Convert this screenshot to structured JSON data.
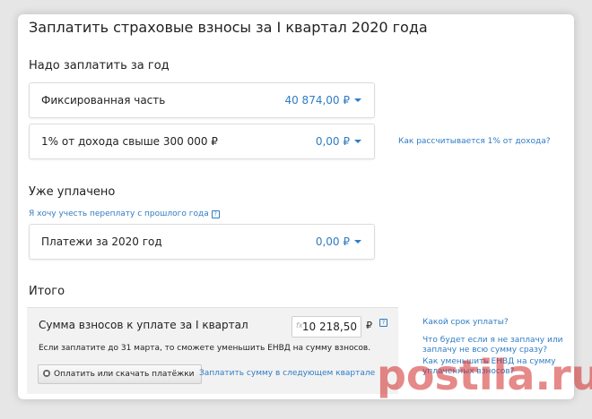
{
  "page": {
    "title": "Заплатить страховые взносы за I квартал 2020 года"
  },
  "to_pay": {
    "heading": "Надо заплатить за год",
    "fixed": {
      "label": "Фиксированная часть",
      "amount": "40 874,00 ₽"
    },
    "percent": {
      "label": "1% от дохода свыше 300 000 ₽",
      "amount": "0,00 ₽"
    },
    "percent_help_link": "Как рассчитывается 1% от дохода?"
  },
  "paid": {
    "heading": "Уже уплачено",
    "overpay_link": "Я хочу учесть переплату с прошлого года",
    "payments": {
      "label": "Платежи за 2020 год",
      "amount": "0,00 ₽"
    }
  },
  "total": {
    "heading": "Итого",
    "label": "Сумма взносов к уплате за I квартал",
    "fx": "fx",
    "value": "10 218,50",
    "currency": "₽",
    "note": "Если заплатите до 31 марта, то сможете уменьшить ЕНВД на сумму взносов.",
    "pay_button": "Оплатить или скачать платёжки",
    "next_quarter_link": "Заплатить сумму в следующем квартале"
  },
  "sidebar_links": [
    "Какой срок уплаты?",
    "Что будет если я не заплачу или заплачу не всю сумму сразу?",
    "Как уменьшить ЕНВД на сумму уплаченных взносов?"
  ],
  "help_glyph": "?",
  "watermark": "postila.ru",
  "colors": {
    "link": "#2f7cc4",
    "watermark": "#d22828"
  }
}
